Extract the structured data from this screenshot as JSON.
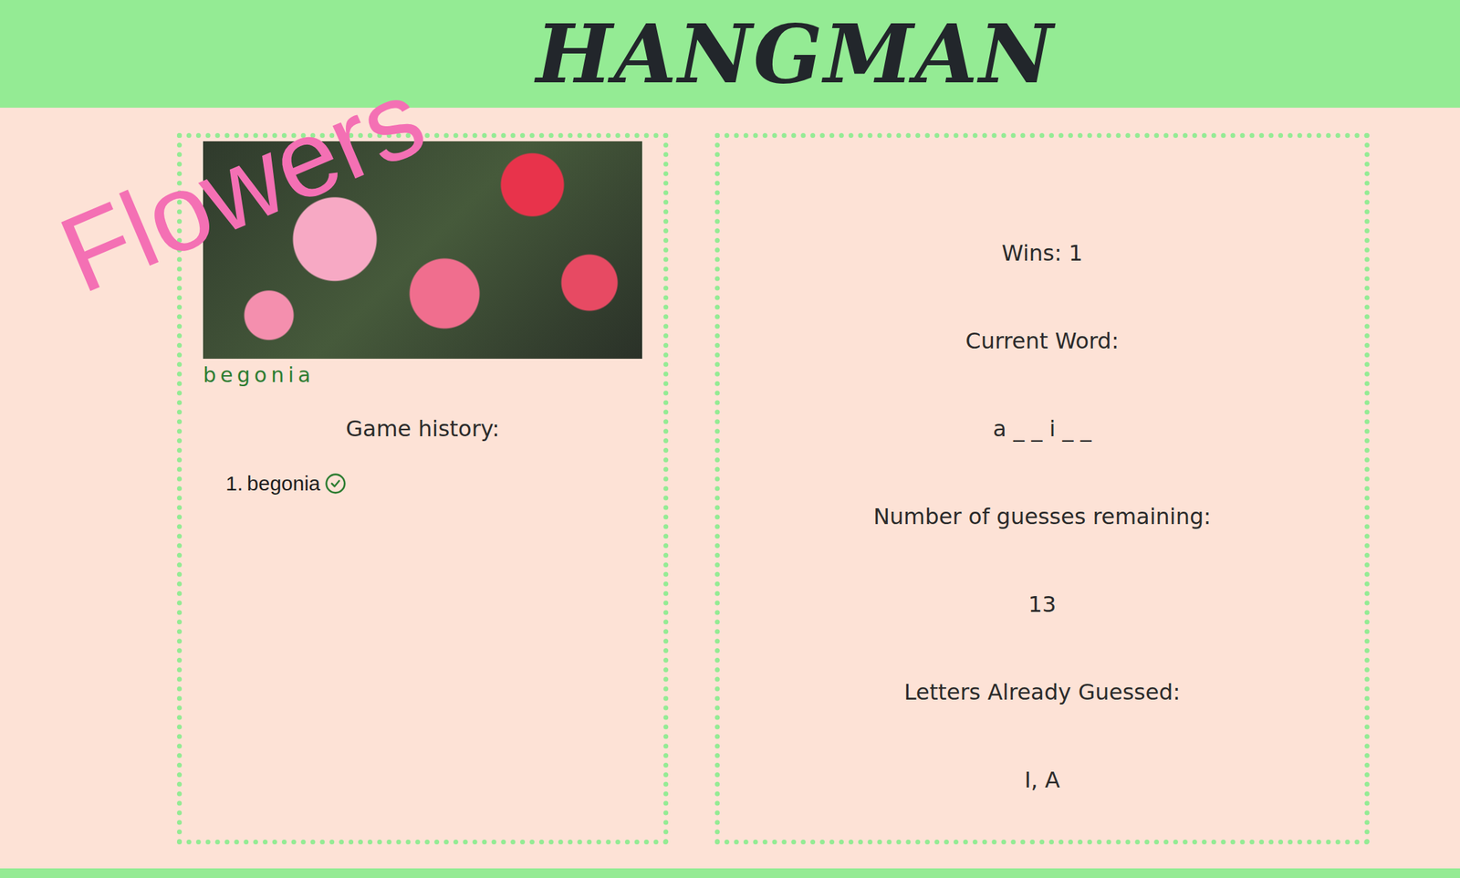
{
  "header": {
    "title": "HANGMAN"
  },
  "category": {
    "label": "Flowers"
  },
  "reveal": {
    "word": "begonia"
  },
  "history": {
    "title": "Game history:",
    "items": [
      {
        "index": "1.",
        "word": "begonia",
        "won": true
      }
    ]
  },
  "stats": [
    {
      "label": "Wins: 1",
      "value": ""
    },
    {
      "label": "Current Word:",
      "value": "a _ _ i _ _"
    },
    {
      "label": "Number of guesses remaining:",
      "value": "13"
    },
    {
      "label": "Letters Already Guessed:",
      "value": "I, A"
    }
  ]
}
